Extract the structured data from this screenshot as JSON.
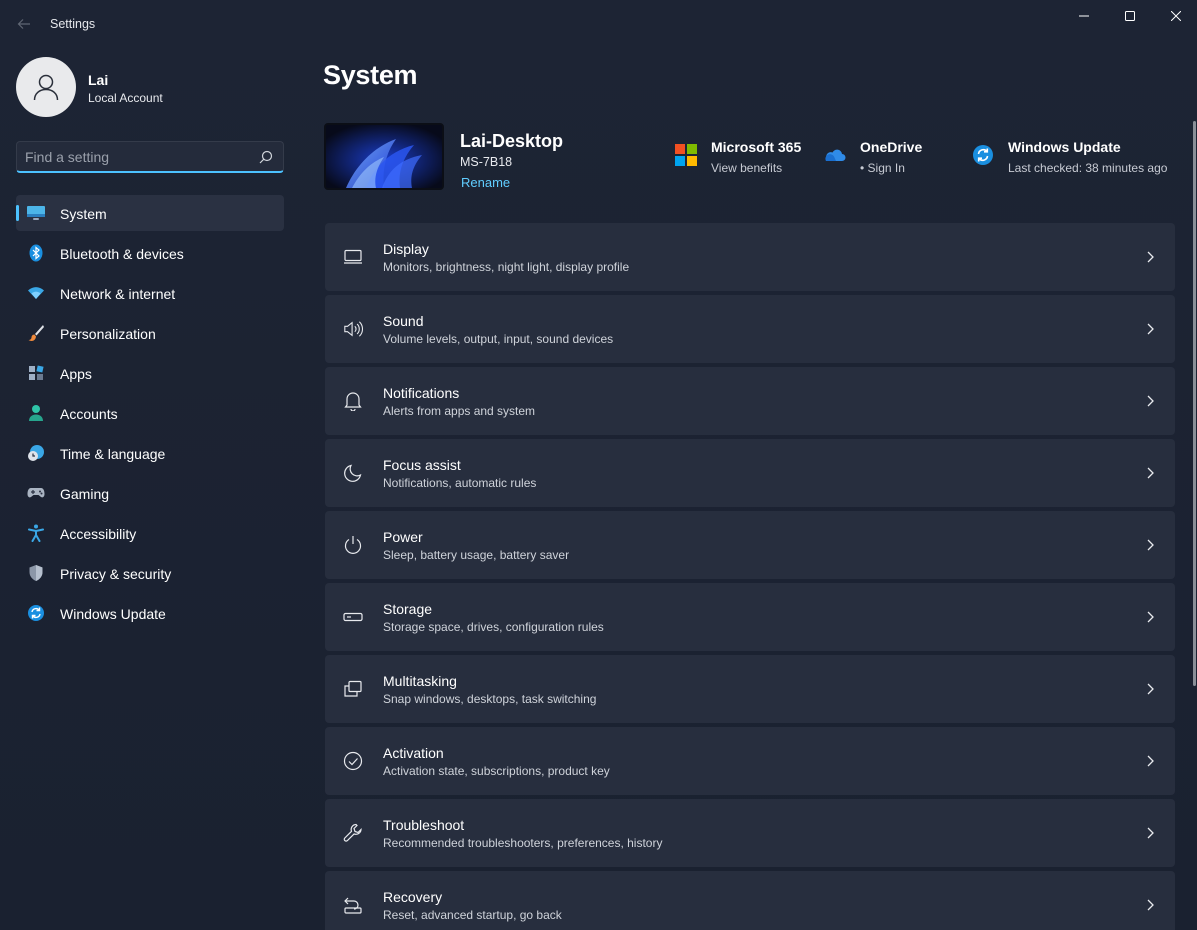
{
  "window": {
    "title": "Settings",
    "controls": [
      "minimize",
      "maximize",
      "close"
    ]
  },
  "profile": {
    "name": "Lai",
    "account_type": "Local Account"
  },
  "search": {
    "placeholder": "Find a setting"
  },
  "sidebar": {
    "active": "System",
    "items": [
      {
        "label": "System",
        "icon": "display-icon"
      },
      {
        "label": "Bluetooth & devices",
        "icon": "bluetooth-icon"
      },
      {
        "label": "Network & internet",
        "icon": "wifi-icon"
      },
      {
        "label": "Personalization",
        "icon": "brush-icon"
      },
      {
        "label": "Apps",
        "icon": "apps-icon"
      },
      {
        "label": "Accounts",
        "icon": "person-icon"
      },
      {
        "label": "Time & language",
        "icon": "clock-globe-icon"
      },
      {
        "label": "Gaming",
        "icon": "gamepad-icon"
      },
      {
        "label": "Accessibility",
        "icon": "accessibility-icon"
      },
      {
        "label": "Privacy & security",
        "icon": "shield-icon"
      },
      {
        "label": "Windows Update",
        "icon": "update-icon"
      }
    ]
  },
  "main": {
    "title": "System",
    "device": {
      "name": "Lai-Desktop",
      "model": "MS-7B18",
      "rename_label": "Rename"
    },
    "quick_links": [
      {
        "title": "Microsoft 365",
        "subtitle": "View benefits",
        "icon": "microsoft-logo-icon"
      },
      {
        "title": "OneDrive",
        "subtitle": "• Sign In",
        "icon": "onedrive-cloud-icon"
      },
      {
        "title": "Windows Update",
        "subtitle": "Last checked: 38 minutes ago",
        "icon": "windows-update-icon"
      }
    ],
    "cards": [
      {
        "title": "Display",
        "subtitle": "Monitors, brightness, night light, display profile",
        "icon": "monitor-icon"
      },
      {
        "title": "Sound",
        "subtitle": "Volume levels, output, input, sound devices",
        "icon": "speaker-icon"
      },
      {
        "title": "Notifications",
        "subtitle": "Alerts from apps and system",
        "icon": "bell-icon"
      },
      {
        "title": "Focus assist",
        "subtitle": "Notifications, automatic rules",
        "icon": "moon-icon"
      },
      {
        "title": "Power",
        "subtitle": "Sleep, battery usage, battery saver",
        "icon": "power-icon"
      },
      {
        "title": "Storage",
        "subtitle": "Storage space, drives, configuration rules",
        "icon": "drive-icon"
      },
      {
        "title": "Multitasking",
        "subtitle": "Snap windows, desktops, task switching",
        "icon": "multitask-icon"
      },
      {
        "title": "Activation",
        "subtitle": "Activation state, subscriptions, product key",
        "icon": "check-circle-icon"
      },
      {
        "title": "Troubleshoot",
        "subtitle": "Recommended troubleshooters, preferences, history",
        "icon": "wrench-icon"
      },
      {
        "title": "Recovery",
        "subtitle": "Reset, advanced startup, go back",
        "icon": "recovery-icon"
      }
    ]
  },
  "colors": {
    "accent": "#4cc2ff",
    "link": "#60cdff",
    "card_bg": "#272e3e",
    "window_bg": "#1c2331"
  }
}
